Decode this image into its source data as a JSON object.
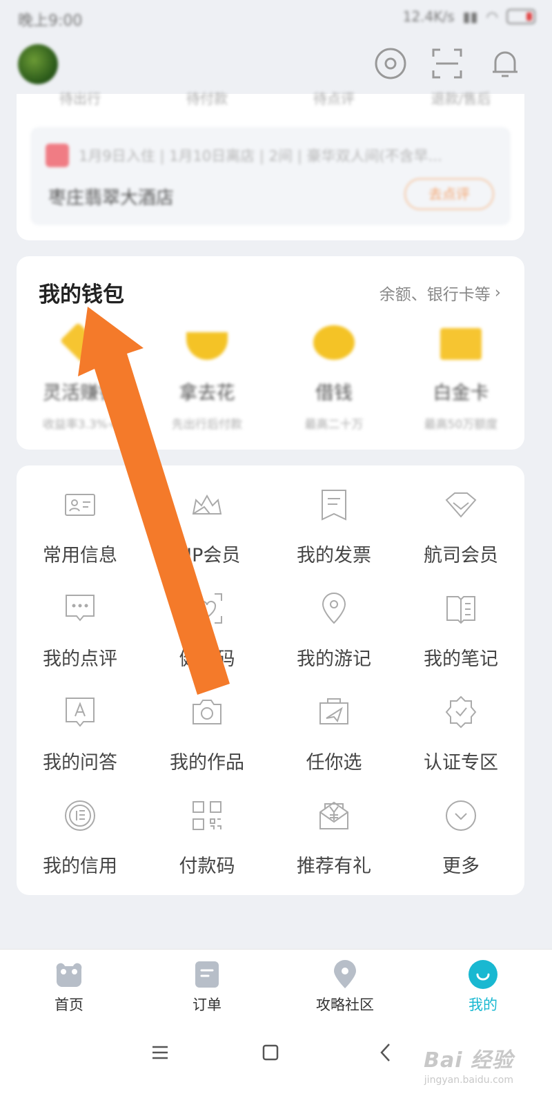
{
  "status_bar": {
    "time": "晚上9:00",
    "network": "12.4K/s"
  },
  "order": {
    "tabs": [
      "待出行",
      "待付款",
      "待点评",
      "退款/售后"
    ],
    "description": "1月9日入住 | 1月10日离店 | 2间 | 豪华双人间(不含早...",
    "hotel": "枣庄翡翠大酒店",
    "action": "去点评"
  },
  "wallet": {
    "title": "我的钱包",
    "link": "余额、银行卡等",
    "items": [
      {
        "name": "灵活赚钱",
        "sub": "收益率3.3%+",
        "icon": "gem-icon"
      },
      {
        "name": "拿去花",
        "sub": "先出行后付款",
        "icon": "bowl-icon"
      },
      {
        "name": "借钱",
        "sub": "最高二十万",
        "icon": "coin-pot-icon"
      },
      {
        "name": "白金卡",
        "sub": "最高50万额度",
        "icon": "card-icon"
      }
    ]
  },
  "services": [
    {
      "label": "常用信息",
      "icon": "id-card-icon"
    },
    {
      "label": "VIP会员",
      "icon": "crown-icon"
    },
    {
      "label": "我的发票",
      "icon": "invoice-icon"
    },
    {
      "label": "航司会员",
      "icon": "diamond-icon"
    },
    {
      "label": "我的点评",
      "icon": "comment-icon"
    },
    {
      "label": "健康码",
      "icon": "health-code-icon"
    },
    {
      "label": "我的游记",
      "icon": "location-pin-icon"
    },
    {
      "label": "我的笔记",
      "icon": "notebook-icon"
    },
    {
      "label": "我的问答",
      "icon": "qa-icon"
    },
    {
      "label": "我的作品",
      "icon": "camera-icon"
    },
    {
      "label": "任你选",
      "icon": "plane-ticket-icon"
    },
    {
      "label": "认证专区",
      "icon": "verified-badge-icon"
    },
    {
      "label": "我的信用",
      "icon": "credit-icon"
    },
    {
      "label": "付款码",
      "icon": "qr-code-icon"
    },
    {
      "label": "推荐有礼",
      "icon": "gift-envelope-icon"
    },
    {
      "label": "更多",
      "icon": "chevron-down-circle-icon"
    }
  ],
  "tabbar": [
    {
      "label": "首页",
      "icon": "home-mascot-icon",
      "active": false
    },
    {
      "label": "订单",
      "icon": "order-icon",
      "active": false
    },
    {
      "label": "攻略社区",
      "icon": "community-pin-icon",
      "active": false
    },
    {
      "label": "我的",
      "icon": "profile-smile-icon",
      "active": true
    }
  ],
  "watermark": {
    "main": "Bai 经验",
    "sub": "jingyan.baidu.com"
  },
  "colors": {
    "accent": "#19b8d1",
    "arrow": "#f47a2a",
    "wallet_yellow": "#f4c326"
  }
}
